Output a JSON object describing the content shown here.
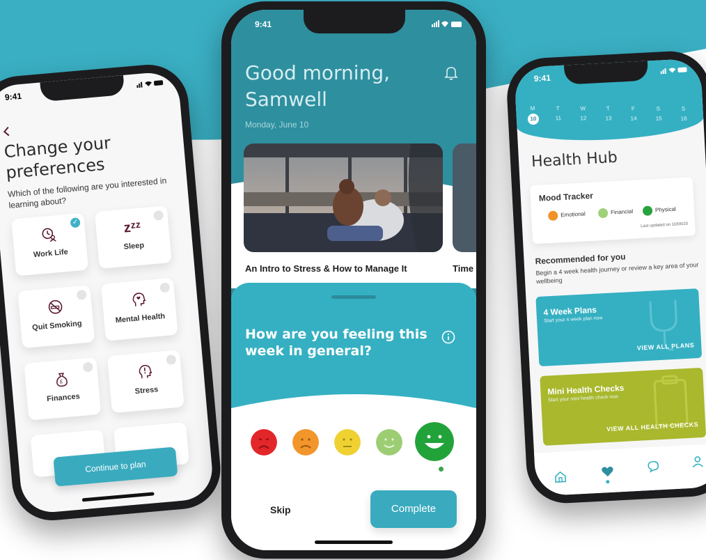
{
  "colors": {
    "teal": "#35b0c2",
    "teal_dark": "#2e8f9f",
    "maroon_icon": "#5a1a2e",
    "olive_card": "#a9b82c"
  },
  "left_phone": {
    "status_time": "9:41",
    "back_icon": "back-arrow-icon",
    "title": "Change your preferences",
    "subtitle": "Which of the following are you interested in learning about?",
    "tiles": [
      {
        "label": "Work Life",
        "icon": "clock-person-icon",
        "selected": true
      },
      {
        "label": "Sleep",
        "icon": "zzz-icon",
        "selected": false
      },
      {
        "label": "Quit Smoking",
        "icon": "no-smoking-icon",
        "selected": false
      },
      {
        "label": "Mental Health",
        "icon": "head-heart-icon",
        "selected": false
      },
      {
        "label": "Finances",
        "icon": "money-bag-icon",
        "selected": false
      },
      {
        "label": "Stress",
        "icon": "head-exclamation-icon",
        "selected": false
      }
    ],
    "continue_label": "Continue to plan"
  },
  "center_phone": {
    "status_time": "9:41",
    "greeting": "Good morning, Samwell",
    "date": "Monday, June 10",
    "article_title": "An Intro to Stress & How to Manage It",
    "article_title_next": "Time",
    "question": "How are you feeling this week in general?",
    "faces": [
      "very-sad-face-icon",
      "sad-face-icon",
      "neutral-face-icon",
      "smile-face-icon",
      "big-smile-face-icon"
    ],
    "selected_face_index": 4,
    "skip_label": "Skip",
    "complete_label": "Complete"
  },
  "right_phone": {
    "status_time": "9:41",
    "week": [
      {
        "d": "M",
        "n": "10",
        "selected": true
      },
      {
        "d": "T",
        "n": "11"
      },
      {
        "d": "W",
        "n": "12"
      },
      {
        "d": "T",
        "n": "13"
      },
      {
        "d": "F",
        "n": "14"
      },
      {
        "d": "S",
        "n": "15"
      },
      {
        "d": "S",
        "n": "16"
      }
    ],
    "title": "Health Hub",
    "mood_tracker": {
      "title": "Mood Tracker",
      "items": [
        {
          "label": "Emotional",
          "color": "#f0922a"
        },
        {
          "label": "Financial",
          "color": "#9fd07a"
        },
        {
          "label": "Physical",
          "color": "#27a33d"
        }
      ],
      "updated": "Last updated on 10/06/20"
    },
    "recommended_title": "Recommended for you",
    "recommended_sub": "Begin a 4 week health journey or review a key area of your wellbeing",
    "cards": [
      {
        "title": "4 Week Plans",
        "subtitle": "Start your 4 week plan now",
        "action": "VIEW ALL PLANS"
      },
      {
        "title": "Mini Health Checks",
        "subtitle": "Start your mini health check now",
        "action": "VIEW ALL HEALTH CHECKS"
      }
    ],
    "tabs": [
      "home-icon",
      "heart-icon",
      "chat-icon",
      "profile-icon"
    ],
    "active_tab_index": 1
  }
}
